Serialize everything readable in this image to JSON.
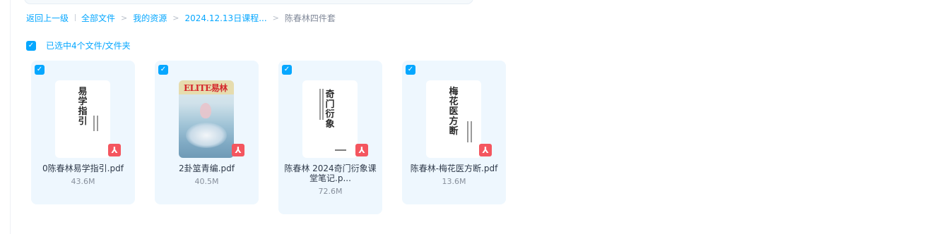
{
  "breadcrumb": {
    "back": "返回上一级",
    "items": [
      "全部文件",
      "我的资源",
      "2024.12.13日课程...",
      "陈春林四件套"
    ]
  },
  "selection": {
    "label": "已选中4个文件/文件夹"
  },
  "files": [
    {
      "name": "0陈春林易学指引.pdf",
      "size": "43.6M",
      "thumb_title": "易学指引",
      "type_icon": "pdf-icon"
    },
    {
      "name": "2卦筮青编.pdf",
      "size": "40.5M",
      "thumb_title": "ELITE易林",
      "type_icon": "pdf-icon"
    },
    {
      "name": "陈春林 2024奇门衍象课堂笔记.p...",
      "size": "72.6M",
      "thumb_title": "奇门衍象",
      "type_icon": "pdf-icon"
    },
    {
      "name": "陈春林-梅花医方断.pdf",
      "size": "13.6M",
      "thumb_title": "梅花医方断",
      "type_icon": "pdf-icon"
    }
  ],
  "colors": {
    "accent": "#06a7ff",
    "card_bg": "#eef7fe",
    "pdf_red": "#f4565f"
  }
}
